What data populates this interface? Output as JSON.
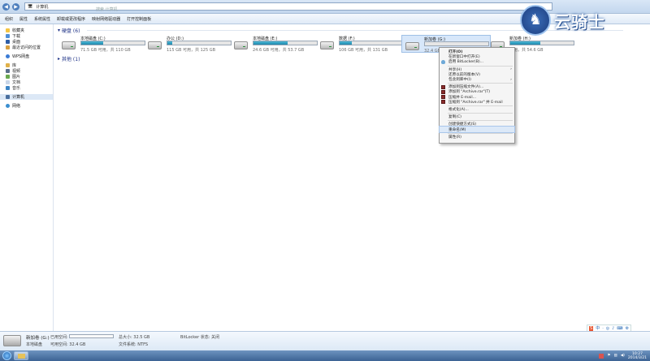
{
  "window": {
    "address": "计算机",
    "search_placeholder": "搜索 计算机"
  },
  "toolbar": [
    "组织",
    "属性",
    "系统属性",
    "卸载或更改程序",
    "映射网络驱动器",
    "打开控制面板"
  ],
  "sidebar": {
    "favorites": "收藏夹",
    "fav_items": [
      "下载",
      "桌面",
      "最近访问的位置"
    ],
    "wps": "WPS网盘",
    "libraries": "库",
    "lib_items": [
      "视频",
      "图片",
      "文档",
      "音乐"
    ],
    "computer": "计算机",
    "network": "网络"
  },
  "sections": {
    "disks": "硬盘 (6)",
    "other": "其他 (1)"
  },
  "drives": [
    {
      "name": "本地磁盘 (C:)",
      "free": "71.5 GB 可用，共 110 GB",
      "used_fraction": 0.35
    },
    {
      "name": "办公 (D:)",
      "free": "115 GB 可用，共 125 GB",
      "used_fraction": 0.08
    },
    {
      "name": "本地磁盘 (E:)",
      "free": "24.6 GB 可用，共 53.7 GB",
      "used_fraction": 0.54
    },
    {
      "name": "数据 (F:)",
      "free": "106 GB 可用，共 131 GB",
      "used_fraction": 0.19
    },
    {
      "name": "新加卷 (G:)",
      "free": "32.4 GB 可用",
      "used_fraction": 0.0
    },
    {
      "name": "新加卷 (H:)",
      "free": "可用，共 54.6 GB",
      "used_fraction": 0.48
    }
  ],
  "context_menu": [
    {
      "label": "打开(O)",
      "bold": true
    },
    {
      "label": "在新窗口中打开(E)"
    },
    {
      "label": "启用 BitLocker(B)...",
      "icon": "shield"
    },
    {
      "sep": true
    },
    {
      "label": "共享(H)",
      "arrow": true
    },
    {
      "label": "还原以前的版本(V)"
    },
    {
      "label": "包含到库中(I)",
      "arrow": true
    },
    {
      "sep": true
    },
    {
      "label": "添加到压缩文件(A)...",
      "icon": "rar"
    },
    {
      "label": "添加到 \"Archive.rar\"(T)",
      "icon": "rar"
    },
    {
      "label": "压缩并 E-mail...",
      "icon": "rar"
    },
    {
      "label": "压缩到 \"Archive.rar\" 并 E-mail",
      "icon": "rar"
    },
    {
      "sep": true
    },
    {
      "label": "格式化(A)..."
    },
    {
      "sep": true
    },
    {
      "label": "复制(C)"
    },
    {
      "sep": true
    },
    {
      "label": "创建快捷方式(S)"
    },
    {
      "label": "重命名(M)",
      "highlight": true
    },
    {
      "sep": true
    },
    {
      "label": "属性(R)"
    }
  ],
  "details": {
    "name": "新加卷 (G:)",
    "used_label": "已用空间:",
    "type_label": "本地磁盘",
    "free": "可用空间: 32.4 GB",
    "total": "总大小: 32.5 GB",
    "fs": "文件系统: NTFS",
    "bitlocker": "BitLocker 状态: 关闭"
  },
  "taskbar": {
    "time": "10:27",
    "date": "2014/3/21"
  },
  "ime": [
    "S",
    "中",
    "·",
    "◎",
    "♪",
    "⌨",
    "⚙"
  ],
  "watermark": {
    "text": "云骑士",
    "icon": "horse-rider-icon"
  }
}
